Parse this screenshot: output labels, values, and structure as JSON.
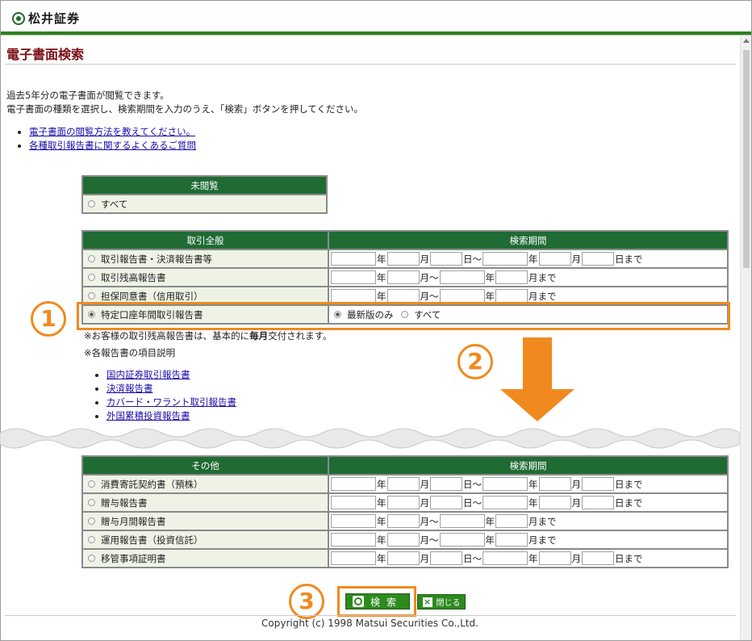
{
  "header": {
    "logo_text": "松井証券"
  },
  "page_title": "電子書面検索",
  "intro": {
    "line1": "過去5年分の電子書面が閲覧できます。",
    "line2": "電子書面の種類を選択し、検索期間を入力のうえ、「検索」ボタンを押してください。"
  },
  "help_links": [
    "電子書面の閲覧方法を教えてください。",
    "各種取引報告書に関するよくあるご質問"
  ],
  "unread_table": {
    "header": "未閲覧",
    "option": "すべて"
  },
  "general_table": {
    "header_left": "取引全般",
    "header_right": "検索期間",
    "rows": [
      "取引報告書・決済報告書等",
      "取引残高報告書",
      "担保同意書（信用取引）",
      "特定口座年間取引報告書"
    ],
    "latest_only": "最新版のみ",
    "all": "すべて"
  },
  "units": {
    "year": "年",
    "month": "月",
    "day_tilde": "日～",
    "month_tilde": "月～",
    "to_day": "日まで",
    "to_month": "月まで"
  },
  "notes": {
    "note1_pre": "※お客様の取引残高報告書は、基本的に",
    "note1_bold": "毎月",
    "note1_post": "交付されます。",
    "note2": "※各報告書の項目説明"
  },
  "report_links": [
    "国内証券取引報告書",
    "決済報告書",
    "カバード・ワラント取引報告書",
    "外国累積投資報告書"
  ],
  "other_table": {
    "header_left": "その他",
    "header_right": "検索期間",
    "rows": [
      "消費寄託契約書（預株）",
      "贈与報告書",
      "贈与月間報告書",
      "運用報告書（投資信託）",
      "移管事項証明書"
    ]
  },
  "callouts": [
    "1",
    "2",
    "3"
  ],
  "buttons": {
    "search": "検索",
    "close": "閉じる"
  },
  "copyright": "Copyright (c) 1998 Matsui Securities Co.,Ltd.",
  "colors": {
    "accent": "#f08a1e",
    "header_green": "#1f6b33",
    "title_red": "#7a0d14"
  }
}
